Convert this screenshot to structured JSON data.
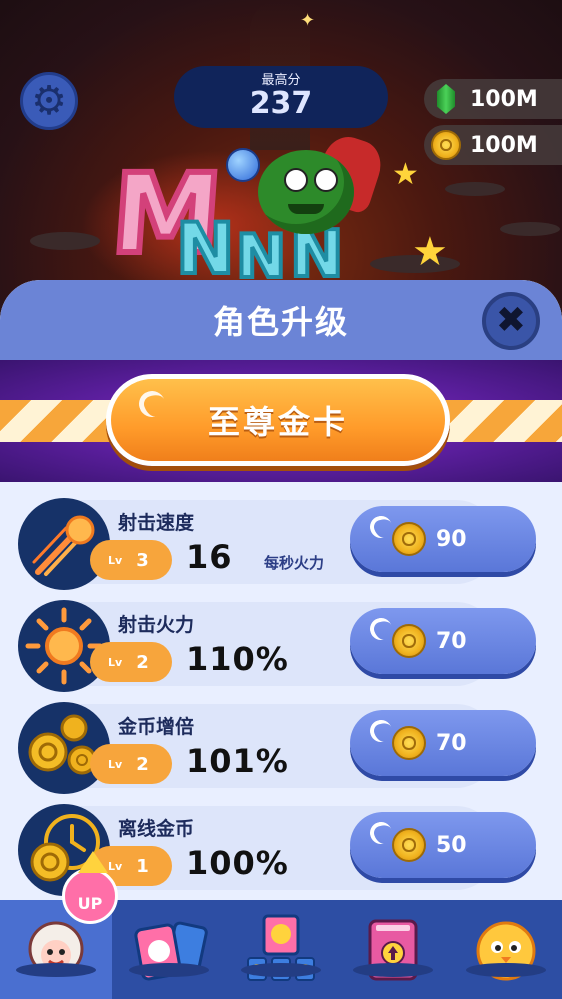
{
  "hud": {
    "best_score_label": "最高分",
    "best_score": "237",
    "gems": "100M",
    "coins": "100M"
  },
  "panel": {
    "title": "角色升级",
    "gold_card_button": "至尊金卡"
  },
  "upgrades": [
    {
      "name": "射击速度",
      "level_prefix": "Lv",
      "level": "3",
      "value": "16",
      "unit": "每秒火力",
      "price": "90",
      "icon": "shot-speed-icon"
    },
    {
      "name": "射击火力",
      "level_prefix": "Lv",
      "level": "2",
      "value": "110%",
      "unit": "",
      "price": "70",
      "icon": "firepower-icon"
    },
    {
      "name": "金币增倍",
      "level_prefix": "Lv",
      "level": "2",
      "value": "101%",
      "unit": "",
      "price": "70",
      "icon": "coin-multiplier-icon"
    },
    {
      "name": "离线金币",
      "level_prefix": "Lv",
      "level": "1",
      "value": "100%",
      "unit": "",
      "price": "50",
      "icon": "offline-coins-icon"
    }
  ],
  "nav": {
    "up_badge": "UP",
    "items": [
      "character-upgrade",
      "cards",
      "skins",
      "book",
      "chick"
    ]
  },
  "colors": {
    "panel_header": "#6b84d6",
    "buy_button": "#5a77d8",
    "gold_button": "#ff9b2a",
    "level_pill": "#f7a53c",
    "nav_bar": "#2d4ea4"
  }
}
